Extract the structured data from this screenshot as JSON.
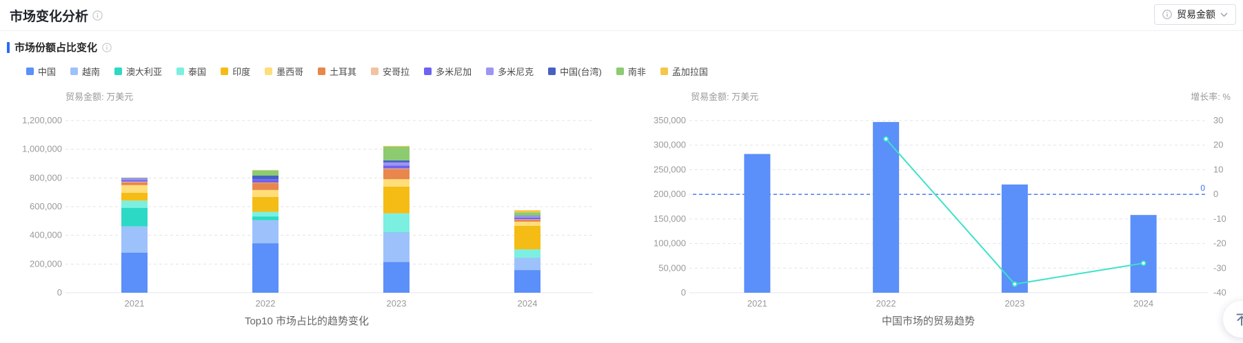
{
  "page": {
    "title": "市场变化分析",
    "section_title": "市场份额占比变化",
    "metric_selector": {
      "label": "贸易金额",
      "icon": "info-circle-icon",
      "chevron": "chevron-down-icon"
    },
    "back_to_top_icon": "arrow-up-to-top"
  },
  "chart_data": [
    {
      "type": "bar",
      "variant": "stacked",
      "title": "Top10 市场占比的趋势变化",
      "axis_name": "贸易金额: 万美元",
      "categories": [
        "2021",
        "2022",
        "2023",
        "2024"
      ],
      "ylim": [
        0,
        1200000
      ],
      "ytick_step": 200000,
      "grid": true,
      "legend_position": "top",
      "series": [
        {
          "name": "中国",
          "color": "#5B8FF9",
          "values": [
            280000,
            345000,
            215000,
            158000
          ]
        },
        {
          "name": "越南",
          "color": "#9DC2FB",
          "values": [
            182000,
            160000,
            205000,
            86000
          ]
        },
        {
          "name": "澳大利亚",
          "color": "#2CD9C5",
          "values": [
            130000,
            27000,
            2000,
            1000
          ]
        },
        {
          "name": "泰国",
          "color": "#7BF0E1",
          "values": [
            50000,
            32000,
            131000,
            57000
          ]
        },
        {
          "name": "印度",
          "color": "#F5BC16",
          "values": [
            54000,
            104000,
            187000,
            165000
          ]
        },
        {
          "name": "墨西哥",
          "color": "#FFDE7A",
          "values": [
            54000,
            48000,
            51000,
            28000
          ]
        },
        {
          "name": "土耳其",
          "color": "#E8864C",
          "values": [
            20000,
            50000,
            72000,
            15000
          ]
        },
        {
          "name": "安哥拉",
          "color": "#F3C2A2",
          "values": [
            4000,
            2000,
            3000,
            2000
          ]
        },
        {
          "name": "多米尼加",
          "color": "#6E62F0",
          "values": [
            12000,
            19000,
            21000,
            12000
          ]
        },
        {
          "name": "多米尼克",
          "color": "#9D95F5",
          "values": [
            10000,
            2000,
            21000,
            10000
          ]
        },
        {
          "name": "中国(台湾)",
          "color": "#4760C4",
          "values": [
            3000,
            27000,
            14000,
            3000
          ]
        },
        {
          "name": "南非",
          "color": "#8CCB70",
          "values": [
            2000,
            37000,
            96000,
            23000
          ]
        },
        {
          "name": "孟加拉国",
          "color": "#F6C64A",
          "values": [
            1000,
            2000,
            5000,
            15000
          ]
        }
      ]
    },
    {
      "type": "bar",
      "variant": "bar-line-combo",
      "title": "中国市场的贸易趋势",
      "left_axis_name": "贸易金额: 万美元",
      "right_axis_name": "增长率: %",
      "categories": [
        "2021",
        "2022",
        "2023",
        "2024"
      ],
      "left_ylim": [
        0,
        350000
      ],
      "left_tick_step": 50000,
      "right_ylim": [
        -40,
        30
      ],
      "right_tick_step": 10,
      "grid": true,
      "bar_series": {
        "name": "贸易金额",
        "color": "#5B8FF9",
        "values": [
          282000,
          347000,
          220000,
          158000
        ]
      },
      "line_series": {
        "name": "增长率",
        "color": "#3BE2C9",
        "values": [
          null,
          22.5,
          -36.5,
          -28
        ]
      },
      "markline": {
        "value": 0,
        "label": "0",
        "color": "#3B6EF3"
      }
    }
  ]
}
